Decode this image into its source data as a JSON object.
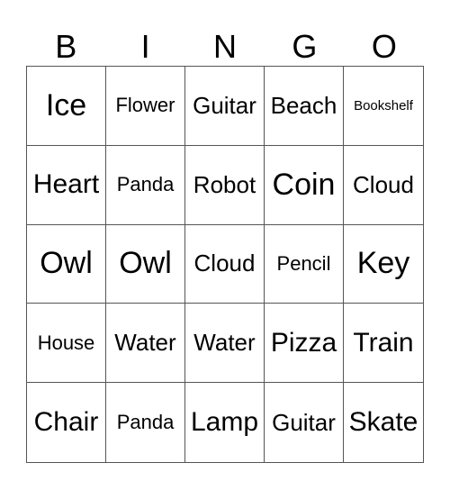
{
  "header": [
    "B",
    "I",
    "N",
    "G",
    "O"
  ],
  "cells": [
    [
      "Ice",
      "Flower",
      "Guitar",
      "Beach",
      "Bookshelf"
    ],
    [
      "Heart",
      "Panda",
      "Robot",
      "Coin",
      "Cloud"
    ],
    [
      "Owl",
      "Owl",
      "Cloud",
      "Pencil",
      "Key"
    ],
    [
      "House",
      "Water",
      "Water",
      "Pizza",
      "Train"
    ],
    [
      "Chair",
      "Panda",
      "Lamp",
      "Guitar",
      "Skate"
    ]
  ]
}
